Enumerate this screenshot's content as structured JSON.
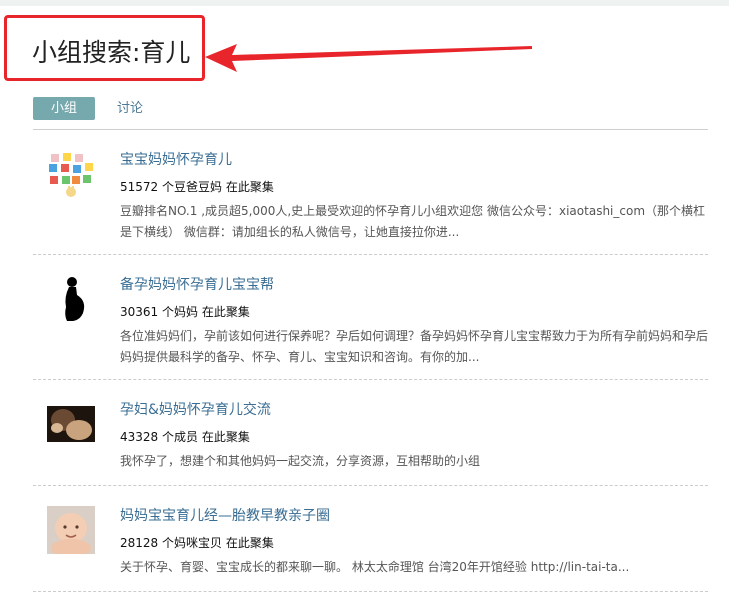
{
  "page": {
    "title": "小组搜索:育儿"
  },
  "tabs": [
    {
      "label": "小组",
      "active": true
    },
    {
      "label": "讨论",
      "active": false
    }
  ],
  "groups": [
    {
      "name": "宝宝妈妈怀孕育儿",
      "count": "51572",
      "member_label": "个豆爸豆妈",
      "gather": "在此聚集",
      "description": "豆瓣排名NO.1 ,成员超5,000人,史上最受欢迎的怀孕育儿小组欢迎您 微信公众号：xiaotashi_com（那个横杠是下横线） 微信群：请加组长的私人微信号，让她直接拉你进...",
      "icon": "miffy-avatar-icon"
    },
    {
      "name": "备孕妈妈怀孕育儿宝宝帮",
      "count": "30361",
      "member_label": "个妈妈",
      "gather": "在此聚集",
      "description": "各位准妈妈们，孕前该如何进行保养呢？孕后如何调理？备孕妈妈怀孕育儿宝宝帮致力于为所有孕前妈妈和孕后妈妈提供最科学的备孕、怀孕、育儿、宝宝知识和咨询。有你的加...",
      "icon": "pregnant-silhouette-icon"
    },
    {
      "name": "孕妇&妈妈怀孕育儿交流",
      "count": "43328",
      "member_label": "个成员",
      "gather": "在此聚集",
      "description": "我怀孕了，想建个和其他妈妈一起交流，分享资源，互相帮助的小组",
      "icon": "pregnant-photo-icon"
    },
    {
      "name": "妈妈宝宝育儿经—胎教早教亲子圈",
      "count": "28128",
      "member_label": "个妈咪宝贝",
      "gather": "在此聚集",
      "description": "关于怀孕、育婴、宝宝成长的都来聊一聊。 林太太命理馆 台湾20年开馆经验 http://lin-tai-ta...",
      "icon": "baby-photo-icon"
    }
  ],
  "colors": {
    "highlight_box": "#e8252a",
    "tab_active_bg": "#76a9ad",
    "link": "#3a6d93"
  }
}
